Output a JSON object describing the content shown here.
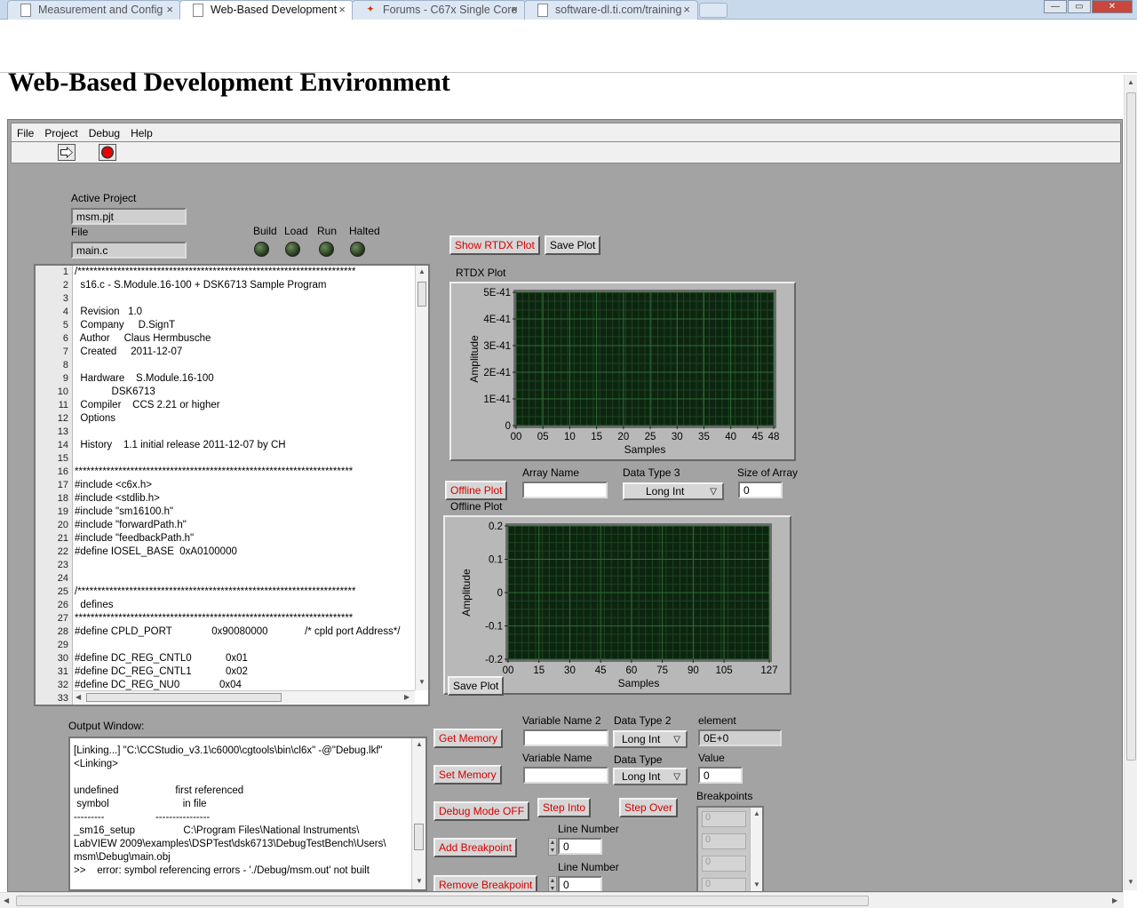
{
  "browser": {
    "tabs": [
      {
        "title": "Measurement and Config",
        "icon": "page-icon"
      },
      {
        "title": "Web-Based Development",
        "icon": "page-icon"
      },
      {
        "title": "Forums - C67x Single Core",
        "icon": "ti-logo-icon"
      },
      {
        "title": "software-dl.ti.com/training",
        "icon": "page-icon"
      }
    ],
    "close_glyph": "×",
    "window_buttons": [
      "—",
      "▭",
      "✕"
    ]
  },
  "page": {
    "title": "Web-Based Development Environment"
  },
  "menu": [
    "File",
    "Project",
    "Debug",
    "Help"
  ],
  "project": {
    "active_label": "Active Project",
    "active_value": "msm.pjt",
    "file_label": "File",
    "file_value": "main.c"
  },
  "leds": [
    "Build",
    "Load",
    "Run",
    "Halted"
  ],
  "code_lines": [
    "/**********************************************************************",
    "  s16.c - S.Module.16-100 + DSK6713 Sample Program",
    "",
    "  Revision   1.0",
    "  Company     D.SignT",
    "  Author     Claus Hermbusche",
    "  Created     2011-12-07",
    "",
    "  Hardware    S.Module.16-100",
    "             DSK6713",
    "  Compiler    CCS 2.21 or higher",
    "  Options",
    "",
    "  History    1.1 initial release 2011-12-07 by CH",
    "",
    "**********************************************************************",
    "#include <c6x.h>",
    "#include <stdlib.h>",
    "#include \"sm16100.h\"",
    "#include \"forwardPath.h\"",
    "#include \"feedbackPath.h\"",
    "#define IOSEL_BASE  0xA0100000",
    "",
    "",
    "/**********************************************************************",
    "  defines",
    "**********************************************************************",
    "#define CPLD_PORT              0x90080000             /* cpld port Address*/",
    "",
    "#define DC_REG_CNTL0            0x01",
    "#define DC_REG_CNTL1            0x02",
    "#define DC_REG_NU0              0x04",
    ""
  ],
  "rtdx": {
    "show_button": "Show RTDX Plot",
    "save_button": "Save Plot",
    "plot_label": "RTDX Plot"
  },
  "offline": {
    "button": "Offline Plot",
    "plot_label": "Offline Plot",
    "array_name_label": "Array Name",
    "array_name_value": "",
    "data_type_label": "Data Type 3",
    "data_type_value": "Long Int",
    "size_label": "Size of Array",
    "size_value": "0",
    "save_button": "Save Plot"
  },
  "chart_data": [
    {
      "type": "line",
      "title": "RTDX Plot",
      "xlabel": "Samples",
      "ylabel": "Amplitude",
      "x_ticks": [
        "00",
        "05",
        "10",
        "15",
        "20",
        "25",
        "30",
        "35",
        "40",
        "45",
        "48"
      ],
      "y_ticks": [
        "5E-41",
        "4E-41",
        "3E-41",
        "2E-41",
        "1E-41",
        "0"
      ],
      "xlim": [
        0,
        48
      ],
      "ylim": [
        0,
        5e-41
      ],
      "grid": true,
      "series": []
    },
    {
      "type": "line",
      "title": "Offline Plot",
      "xlabel": "Samples",
      "ylabel": "Amplitude",
      "x_ticks": [
        "00",
        "15",
        "30",
        "45",
        "60",
        "75",
        "90",
        "105",
        "127"
      ],
      "y_ticks": [
        "0.2",
        "0.1",
        "0",
        "-0.1",
        "-0.2"
      ],
      "xlim": [
        0,
        127
      ],
      "ylim": [
        -0.2,
        0.2
      ],
      "grid": true,
      "series": []
    }
  ],
  "output": {
    "label": "Output Window:",
    "lines": [
      "[Linking...] \"C:\\CCStudio_v3.1\\c6000\\cgtools\\bin\\cl6x\" -@\"Debug.lkf\"",
      "<Linking>",
      "",
      "undefined                    first referenced",
      " symbol                          in file",
      "---------                  ----------------",
      "_sm16_setup                 C:\\Program Files\\National Instruments\\",
      "LabVIEW 2009\\examples\\DSPTest\\dsk6713\\DebugTestBench\\Users\\",
      "msm\\Debug\\main.obj",
      ">>    error: symbol referencing errors - './Debug/msm.out' not built"
    ]
  },
  "memory": {
    "get_button": "Get Memory",
    "set_button": "Set Memory",
    "var2_label": "Variable Name 2",
    "var2_value": "",
    "dt2_label": "Data Type 2",
    "dt2_value": "Long Int",
    "element_label": "element",
    "element_value": "0E+0",
    "var_label": "Variable Name",
    "var_value": "",
    "dt_label": "Data Type",
    "dt_value": "Long Int",
    "value_label": "Value",
    "value_value": "0"
  },
  "debug": {
    "mode_button": "Debug Mode OFF",
    "step_into": "Step Into",
    "step_over": "Step Over",
    "add_bp": "Add Breakpoint",
    "remove_bp": "Remove Breakpoint",
    "line1_label": "Line Number",
    "line1_value": "0",
    "line2_label": "Line Number",
    "line2_value": "0",
    "bp_label": "Breakpoints",
    "bp_items": [
      "0",
      "0",
      "0",
      "0"
    ]
  },
  "colors": {
    "plot_bg": "#0d2510",
    "grid": "#2f6b35",
    "button_red": "#d40000",
    "panel": "#a3a3a3"
  }
}
